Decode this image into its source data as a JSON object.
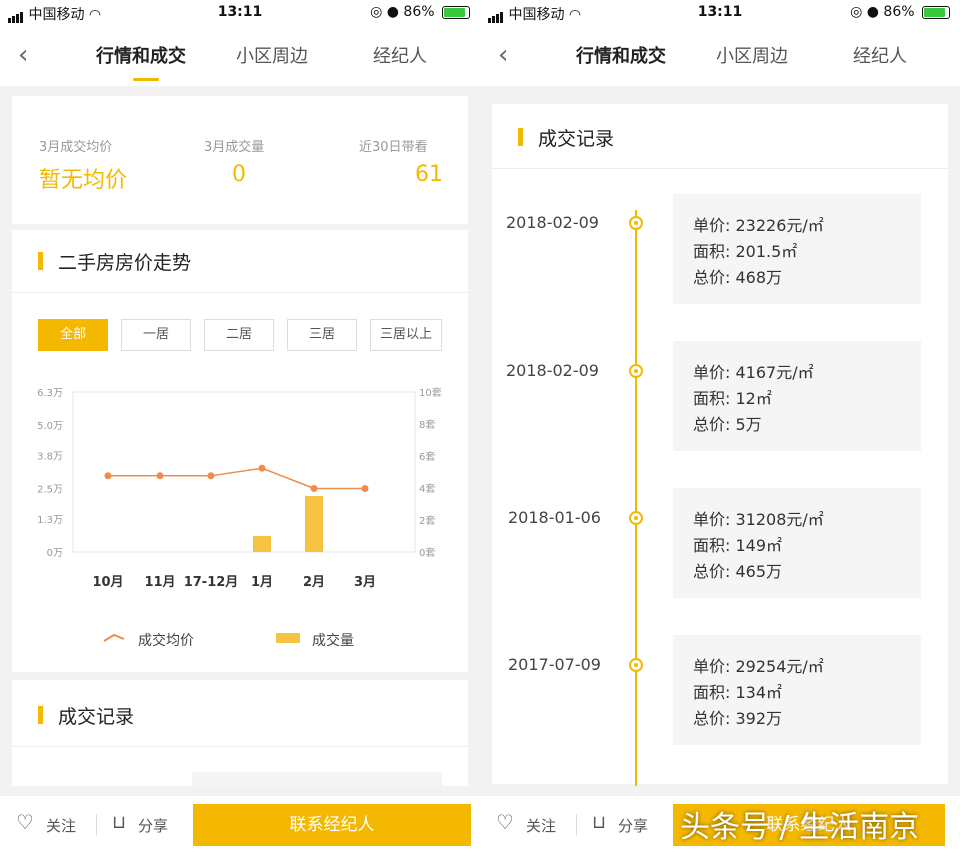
{
  "status_bar": {
    "carrier": "中国移动",
    "time": "13:11",
    "battery": "86%",
    "battery_level": 0.86
  },
  "nav": {
    "tabs": [
      "行情和成交",
      "小区周边",
      "经纪人"
    ],
    "active_tab": 0
  },
  "stats": [
    {
      "label": "3月成交均价",
      "value": "暂无均价"
    },
    {
      "label": "3月成交量",
      "value": "0"
    },
    {
      "label": "近30日带看",
      "value": "61"
    }
  ],
  "trend": {
    "title": "二手房房价走势",
    "filters": [
      "全部",
      "一居",
      "二居",
      "三居",
      "三居以上"
    ],
    "active_filter": 0
  },
  "chart_data": {
    "type": "line",
    "categories": [
      "10月",
      "11月",
      "17-12月",
      "1月",
      "2月",
      "3月"
    ],
    "series": [
      {
        "name": "成交均价",
        "type": "line",
        "axis": "left",
        "values": [
          3.0,
          3.0,
          3.0,
          3.3,
          2.5,
          2.5
        ]
      },
      {
        "name": "成交量",
        "type": "bar",
        "axis": "right",
        "values": [
          0,
          0,
          0,
          1,
          3.5,
          0
        ]
      }
    ],
    "left_axis": {
      "ticks": [
        "6.3万",
        "5.0万",
        "3.8万",
        "2.5万",
        "1.3万",
        "0万"
      ],
      "values": [
        6.3,
        5.0,
        3.8,
        2.5,
        1.3,
        0
      ],
      "ylim": [
        0,
        6.3
      ]
    },
    "right_axis": {
      "ticks": [
        "10套",
        "8套",
        "6套",
        "4套",
        "2套",
        "0套"
      ],
      "values": [
        10,
        8,
        6,
        4,
        2,
        0
      ],
      "ylim": [
        0,
        10
      ]
    },
    "legend": {
      "line": "成交均价",
      "bar": "成交量",
      "placement": "bottom"
    },
    "colors": {
      "line": "#f08c4a",
      "bar": "#f5c242"
    }
  },
  "records_title": "成交记录",
  "records": [
    {
      "date": "2018-02-09",
      "unit_price": "单价: 23226元/㎡",
      "area": "面积: 201.5㎡",
      "total": "总价: 468万"
    },
    {
      "date": "2018-02-09",
      "unit_price": "单价: 4167元/㎡",
      "area": "面积: 12㎡",
      "total": "总价: 5万"
    },
    {
      "date": "2018-01-06",
      "unit_price": "单价: 31208元/㎡",
      "area": "面积: 149㎡",
      "total": "总价: 465万"
    },
    {
      "date": "2017-07-09",
      "unit_price": "单价: 29254元/㎡",
      "area": "面积: 134㎡",
      "total": "总价: 392万"
    }
  ],
  "bottom_bar": {
    "follow": "关注",
    "share": "分享",
    "contact": "联系经纪人"
  },
  "watermark": "头条号 / 生活南京",
  "icons": {
    "back": "back-arrow-icon",
    "follow": "heart-icon",
    "share": "share-icon",
    "wifi": "wifi-icon"
  },
  "accent_color": "#f5b800"
}
